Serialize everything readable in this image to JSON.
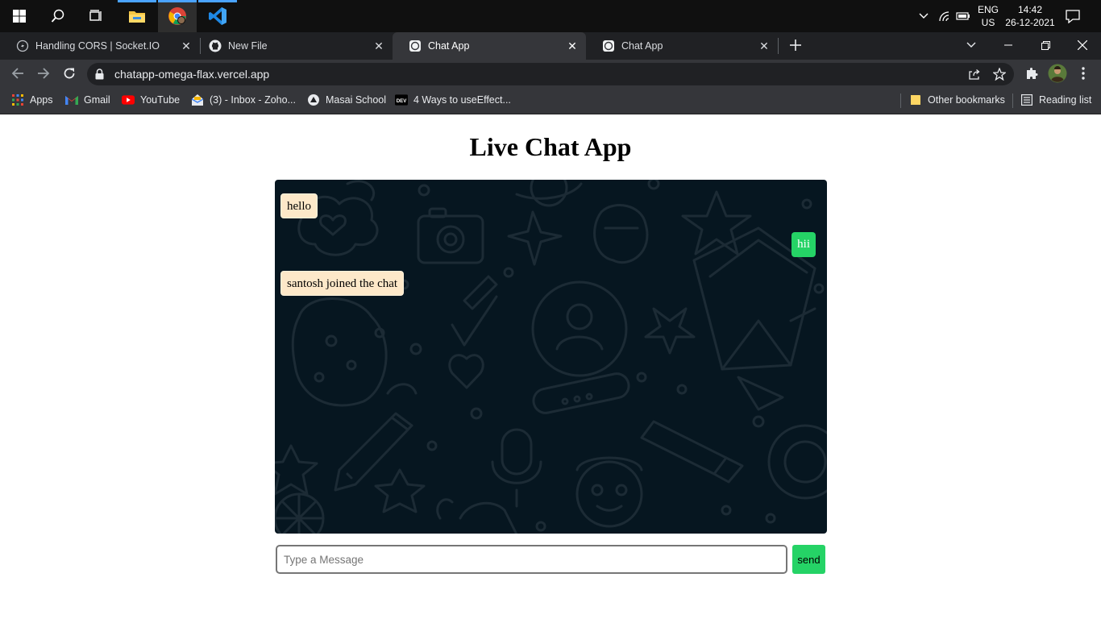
{
  "taskbar": {
    "icons": [
      "windows-start-icon",
      "search-icon",
      "task-view-icon",
      "file-explorer-icon",
      "chrome-icon",
      "vscode-icon"
    ],
    "tray": {
      "lang_top": "ENG",
      "lang_bottom": "US",
      "time": "14:42",
      "date": "26-12-2021"
    }
  },
  "tabs": [
    {
      "title": "Handling CORS | Socket.IO",
      "active": false
    },
    {
      "title": "New File",
      "active": false
    },
    {
      "title": "Chat App",
      "active": true
    },
    {
      "title": "Chat App",
      "active": false
    }
  ],
  "addressbar": {
    "url": "chatapp-omega-flax.vercel.app"
  },
  "bookmarks": [
    {
      "label": "Apps",
      "icon": "apps-grid-icon"
    },
    {
      "label": "Gmail",
      "icon": "gmail-icon"
    },
    {
      "label": "YouTube",
      "icon": "youtube-icon"
    },
    {
      "label": "(3) - Inbox - Zoho...",
      "icon": "zoho-mail-icon"
    },
    {
      "label": "Masai School",
      "icon": "masai-school-icon"
    },
    {
      "label": "4 Ways to useEffect...",
      "icon": "dev-icon"
    }
  ],
  "bookmarks_right": {
    "other": "Other bookmarks",
    "reading": "Reading list"
  },
  "page": {
    "title": "Live Chat App",
    "messages": [
      {
        "text": "hello",
        "side": "left"
      },
      {
        "text": "hii",
        "side": "right"
      },
      {
        "text": "santosh joined the chat",
        "side": "left"
      }
    ],
    "input": {
      "placeholder": "Type a Message",
      "value": ""
    },
    "send_label": "send"
  },
  "colors": {
    "chat_background": "#061620",
    "sent_bubble": "#25d366",
    "received_bubble": "#fde8c9",
    "chrome_tabstrip": "#202124",
    "chrome_toolbar": "#35363a"
  }
}
